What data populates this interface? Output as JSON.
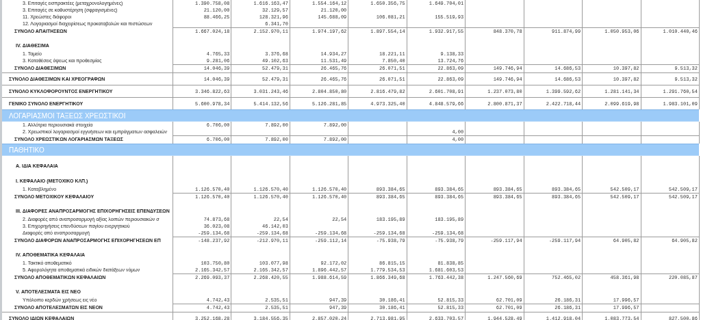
{
  "rows": [
    {
      "kind": "item",
      "label": "3. Επιταγές εισπρακτέες (μεταχρονολογημένες)",
      "cells": {
        "column_1": "1.390.758,08",
        "column_2": "1.616.163,47",
        "column_3": "1.554.164,12",
        "column_4": "1.650.356,75",
        "column_5": "1.649.704,01"
      }
    },
    {
      "kind": "item",
      "label": "3. Επιταγές σε καθυστέρηση (σφραγισμένες)",
      "cells": {
        "column_1": "21.120,00",
        "column_2": "32.129,57",
        "column_3": "21.120,00"
      }
    },
    {
      "kind": "item",
      "label": "11. Χρεώστες διάφοροι",
      "cells": {
        "column_1": "88.466,25",
        "column_2": "128.321,96",
        "column_3": "145.688,09",
        "column_4": "106.081,21",
        "column_5": "155.519,93"
      }
    },
    {
      "kind": "item",
      "label": "12. Λογαριασμοί διαχειρίσεως προκαταβολών και πιστώσεων",
      "cells": {
        "column_2": "6.341,70"
      }
    },
    {
      "kind": "subtotal",
      "label": "ΣΥΝΟΛΟ ΑΠΑΙΤΗΣΕΩΝ",
      "cells": {
        "column_1": "1.667.024,18",
        "column_2": "2.152.970,11",
        "column_3": "1.974.197,62",
        "column_4": "1.897.554,14",
        "column_5": "1.932.917,55",
        "column_6": "848.370,78",
        "column_7": "911.874,99",
        "column_8": "1.050.953,06",
        "column_9": "1.010.440,46"
      }
    },
    {
      "kind": "heading",
      "label": "IV. ΔΙΑΘΕΣΙΜΑ"
    },
    {
      "kind": "item",
      "label": "1. Ταμείο",
      "cells": {
        "column_1": "4.765,33",
        "column_2": "3.376,68",
        "column_3": "14.934,27",
        "column_4": "18.221,11",
        "column_5": "9.138,33"
      }
    },
    {
      "kind": "item",
      "label": "3. Καταθέσεις όψεως και προθεσμίας",
      "cells": {
        "column_1": "9.281,06",
        "column_2": "49.102,63",
        "column_3": "11.531,49",
        "column_4": "7.850,40",
        "column_5": "13.724,76"
      }
    },
    {
      "kind": "subtotal",
      "label": "ΣΥΝΟΛΟ ΔΙΑΘΕΣΙΜΩΝ",
      "cells": {
        "column_1": "14.046,39",
        "column_2": "52.479,31",
        "column_3": "26.465,76",
        "column_4": "26.071,51",
        "column_5": "22.863,09",
        "column_6": "149.746,94",
        "column_7": "14.686,53",
        "column_8": "10.397,82",
        "column_9": "9.513,32"
      }
    },
    {
      "kind": "total",
      "label": "ΣΥΝΟΛΟ ΔΙΑΘΕΣΙΜΩΝ ΚΑΙ ΧΡΕΟΓΡΑΦΩΝ",
      "cells": {
        "column_1": "14.046,39",
        "column_2": "52.479,31",
        "column_3": "26.465,76",
        "column_4": "26.071,51",
        "column_5": "22.863,09",
        "column_6": "149.746,94",
        "column_7": "14.686,53",
        "column_8": "10.397,82",
        "column_9": "9.513,32"
      }
    },
    {
      "kind": "total",
      "label": "ΣΥΝΟΛΟ ΚΥΚΛΟΦΟΡΟΥΝΤΟΣ ΕΝΕΡΓΗΤΙΚΟΥ",
      "cells": {
        "column_1": "3.346.822,63",
        "column_2": "3.031.243,46",
        "column_3": "2.804.850,80",
        "column_4": "2.816.479,82",
        "column_5": "2.601.708,91",
        "column_6": "1.237.073,80",
        "column_7": "1.399.592,62",
        "column_8": "1.281.141,34",
        "column_9": "1.291.760,54"
      }
    },
    {
      "kind": "total",
      "label": "ΓΕΝΙΚΟ ΣΥΝΟΛΟ ΕΝΕΡΓΗΤΙΚΟΥ",
      "cells": {
        "column_1": "5.600.978,34",
        "column_2": "5.414.132,56",
        "column_3": "5.126.281,85",
        "column_4": "4.973.325,40",
        "column_5": "4.848.579,66",
        "column_6": "2.800.871,37",
        "column_7": "2.422.718,44",
        "column_8": "2.099.619,98",
        "column_9": "1.983.101,09"
      }
    },
    {
      "kind": "section",
      "label": "ΛΟΓΑΡΙΑΣΜΟΙ ΤΑΞΕΩΣ ΧΡΕΩΣΤΙΚΟΙ"
    },
    {
      "kind": "item",
      "label": "1. Αλλότρια περιουσιακά στοιχεία",
      "cells": {
        "column_1": "6.706,00",
        "column_2": "7.892,00",
        "column_3": "7.892,00"
      }
    },
    {
      "kind": "item",
      "label": "2. Χρεωστικοί λογαριασμοί εγγυήσεων και εμπράγματων ασφαλειών",
      "cells": {
        "column_5": "4,00"
      }
    },
    {
      "kind": "subtotal",
      "label": "ΣΥΝΟΛΟ ΧΡΕΩΣΤΙΚΩΝ ΛΟΓΑΡΙΑΣΜΩΝ ΤΑΞΕΩΣ",
      "cells": {
        "column_1": "6.706,00",
        "column_2": "7.892,00",
        "column_3": "7.892,00",
        "column_5": "4,00"
      }
    },
    {
      "kind": "section",
      "label": "ΠΑΘΗΤΙΚΟ"
    },
    {
      "kind": "heading",
      "label": "A. ΙΔΙΑ ΚΕΦΑΛΑΙΑ"
    },
    {
      "kind": "heading",
      "label": "I. ΚΕΦΑΛΑΙΟ (ΜΕΤΟΧΙΚΟ ΚΛΠ.)"
    },
    {
      "kind": "item",
      "label": "1. Καταβλημένο",
      "cells": {
        "column_1": "1.126.570,40",
        "column_2": "1.126.570,40",
        "column_3": "1.126.570,40",
        "column_4": "893.384,65",
        "column_5": "893.384,65",
        "column_6": "893.384,65",
        "column_7": "893.384,65",
        "column_8": "542.509,17",
        "column_9": "542.509,17"
      }
    },
    {
      "kind": "subtotal",
      "label": "ΣΥΝΟΛΟ ΜΕΤΟΧΙΚΟΥ ΚΕΦΑΛΑΙΟΥ",
      "cells": {
        "column_1": "1.126.570,40",
        "column_2": "1.126.570,40",
        "column_3": "1.126.570,40",
        "column_4": "893.384,65",
        "column_5": "893.384,65",
        "column_6": "893.384,65",
        "column_7": "893.384,65",
        "column_8": "542.509,17",
        "column_9": "542.509,17"
      }
    },
    {
      "kind": "heading",
      "label": "III. ΔΙΑΦΟΡΕΣ ΑΝΑΠΡΟΣΑΡΜΟΓΗΣ ΕΠΙΧΟΡΗΓΗΣΕΙΣ ΕΠΕΝΔΥΣΕΩΝ"
    },
    {
      "kind": "item",
      "label": "2. Διαφορές από αναπροσαρμογή αξίας λοιπών περιουσιακών σ",
      "cells": {
        "column_1": "74.873,68",
        "column_2": "22,54",
        "column_3": "22,54",
        "column_4": "183.195,89",
        "column_5": "183.195,89"
      }
    },
    {
      "kind": "item",
      "label": "3. Επιχορηγήσεις επενδύσεων παγίου ενεργητικού",
      "cells": {
        "column_1": "36.023,08",
        "column_2": "46.142,03"
      }
    },
    {
      "kind": "item",
      "label": "Διαφορές από αναπροσαρμογή",
      "cells": {
        "column_1": "-259.134,68",
        "column_2": "-259.134,68",
        "column_3": "-259.134,68",
        "column_4": "-259.134,68",
        "column_5": "-259.134,68"
      }
    },
    {
      "kind": "subtotal",
      "label": "ΣΥΝΟΛΟ ΔΙΑΦΟΡΩΝ ΑΝΑΠΡΟΣΑΡΜΟΓΗΣ ΕΠΙΧΟΡΗΓΗΣΕΩΝ ΕΠ",
      "cells": {
        "column_1": "-148.237,92",
        "column_2": "-212.970,11",
        "column_3": "-259.112,14",
        "column_4": "-75.938,79",
        "column_5": "-75.938,79",
        "column_6": "-259.117,94",
        "column_7": "-259.117,94",
        "column_8": "64.905,82",
        "column_9": "64.905,82"
      }
    },
    {
      "kind": "heading",
      "label": "IV. ΑΠΟΘΕΜΑΤΙΚΑ ΚΕΦΑΛΑΙΑ"
    },
    {
      "kind": "item",
      "label": "1. Τακτικό αποθεματικό",
      "cells": {
        "column_1": "103.750,80",
        "column_2": "103.077,98",
        "column_3": "92.172,02",
        "column_4": "86.815,15",
        "column_5": "81.838,85"
      }
    },
    {
      "kind": "item",
      "label": "5. Αφορολόγητα αποθεματικά ειδικών διατάξεων νόμων",
      "cells": {
        "column_1": "2.165.342,57",
        "column_2": "2.165.342,57",
        "column_3": "1.896.442,57",
        "column_4": "1.779.534,53",
        "column_5": "1.681.603,53"
      }
    },
    {
      "kind": "subtotal",
      "label": "ΣΥΝΟΛΟ ΑΠΟΘΕΜΑΤΙΚΩΝ ΚΕΦΑΛΑΙΩΝ",
      "cells": {
        "column_1": "2.269.093,37",
        "column_2": "2.268.420,55",
        "column_3": "1.988.614,59",
        "column_4": "1.866.349,68",
        "column_5": "1.763.442,38",
        "column_6": "1.247.560,69",
        "column_7": "752.465,02",
        "column_8": "458.361,98",
        "column_9": "220.085,87"
      }
    },
    {
      "kind": "heading",
      "label": "V. ΑΠΟΤΕΛΕΣΜΑΤΑ ΕΙΣ ΝΕΟ"
    },
    {
      "kind": "item",
      "label": "Υπόλοιπο κερδών χρήσεως εις νέο",
      "cells": {
        "column_1": "4.742,43",
        "column_2": "2.535,51",
        "column_3": "947,39",
        "column_4": "30.186,41",
        "column_5": "52.815,33",
        "column_6": "62.701,09",
        "column_7": "26.186,31",
        "column_8": "17.996,57"
      }
    },
    {
      "kind": "subtotal",
      "label": "ΣΥΝΟΛΟ ΑΠΟΤΕΛΕΣΜΑΤΩΝ ΕΙΣ ΝΕΟΝ",
      "cells": {
        "column_1": "4.742,43",
        "column_2": "2.535,51",
        "column_3": "947,39",
        "column_4": "30.186,41",
        "column_5": "52.815,33",
        "column_6": "62.701,09",
        "column_7": "26.186,31",
        "column_8": "17.996,57"
      }
    },
    {
      "kind": "total",
      "label": "ΣΥΝΟΛΟ ΙΔΙΩΝ ΚΕΦΑΛΑΙΩΝ",
      "cells": {
        "column_1": "3.252.168,28",
        "column_2": "3.184.556,35",
        "column_3": "2.857.020,24",
        "column_4": "2.713.981,95",
        "column_5": "2.633.703,57",
        "column_6": "1.944.528,49",
        "column_7": "1.412.918,04",
        "column_8": "1.083.773,54",
        "column_9": "827.500,86"
      }
    }
  ]
}
